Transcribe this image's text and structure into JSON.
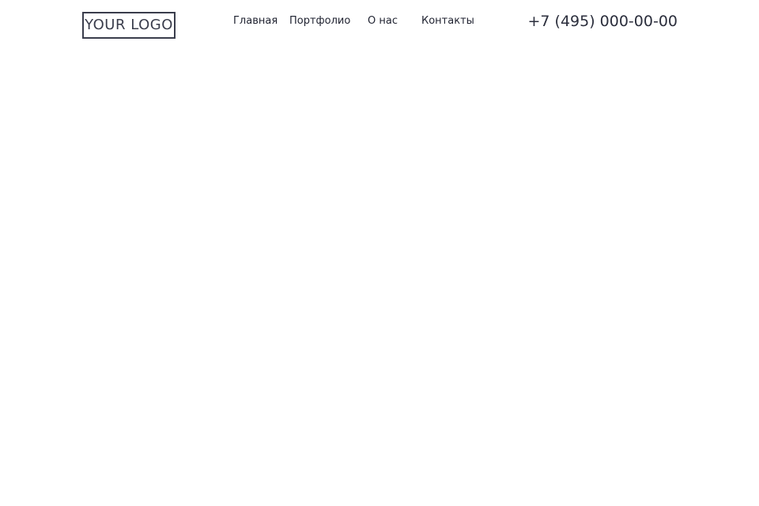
{
  "header": {
    "logo_text": "YOUR LOGO",
    "nav": {
      "home": "Главная",
      "portfolio": "Портфолио",
      "about": "О нас",
      "contacts": "Контакты"
    },
    "phone": "+7 (495) 000-00-00"
  },
  "colors": {
    "background": "#ffffff",
    "text": "#1f2230",
    "logo_border": "#3a3d4c"
  }
}
